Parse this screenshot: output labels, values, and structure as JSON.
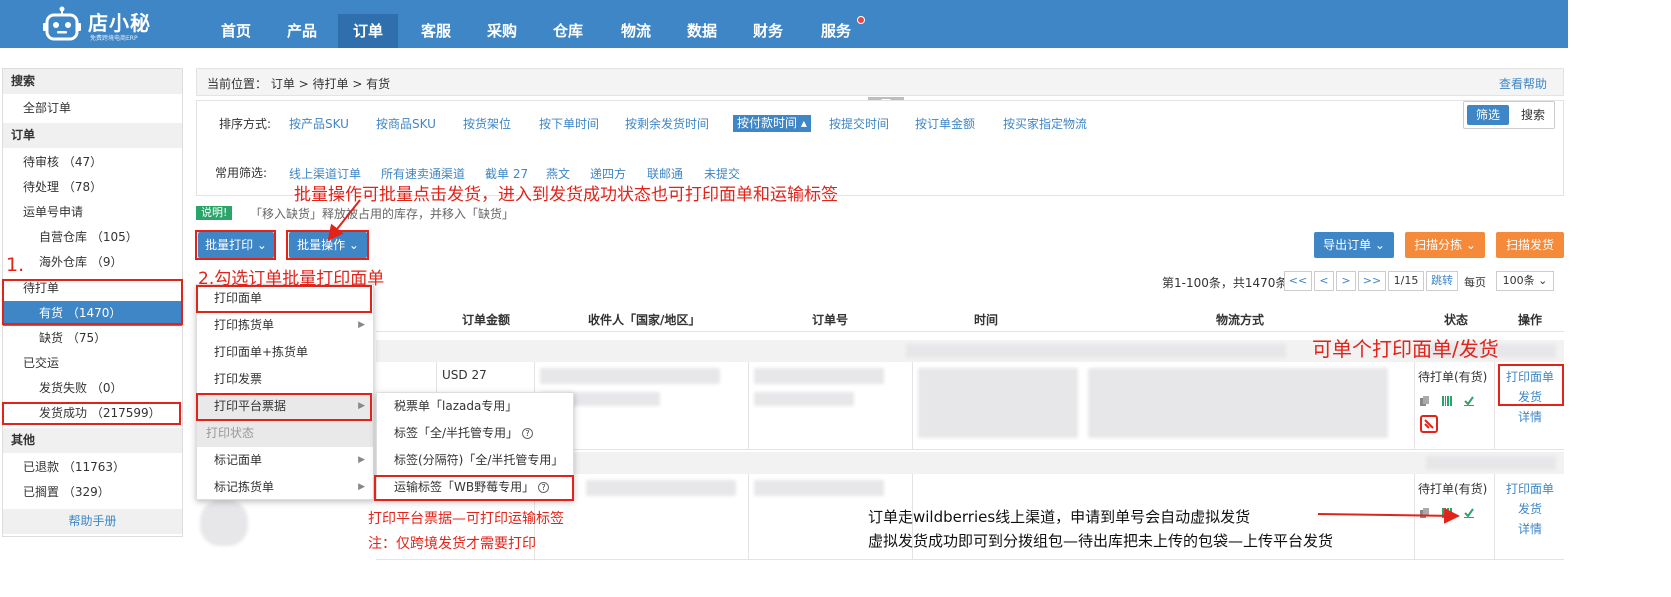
{
  "brand": {
    "name": "店小秘",
    "slogan": "免费跨境电商ERP"
  },
  "nav": [
    {
      "label": "首页"
    },
    {
      "label": "产品"
    },
    {
      "label": "订单"
    },
    {
      "label": "客服"
    },
    {
      "label": "采购"
    },
    {
      "label": "仓库"
    },
    {
      "label": "物流"
    },
    {
      "label": "数据"
    },
    {
      "label": "财务"
    },
    {
      "label": "服务"
    }
  ],
  "nav_active": "订单",
  "sidebar": {
    "search_head": "搜索",
    "all_orders": "全部订单",
    "orders_head": "订单",
    "pending_review": "待审核 （47）",
    "pending_process": "待处理 （78）",
    "waybill_apply": "运单号申请",
    "self_warehouse": "自营仓库 （105）",
    "overseas_warehouse": "海外仓库 （9）",
    "to_print": "待打单",
    "in_stock": "有货 （1470）",
    "out_of_stock": "缺货 （75）",
    "shipped": "已交运",
    "ship_failed": "发货失败 （0）",
    "ship_success": "发货成功 （217599）",
    "other_head": "其他",
    "refunded": "已退款 （11763）",
    "on_hold": "已搁置 （329）",
    "help": "帮助手册"
  },
  "breadcrumb": "当前位置： 订单 > 待打单 > 有货",
  "help_link": "查看帮助",
  "sort": {
    "label": "排序方式:",
    "options": [
      "按产品SKU",
      "按商品SKU",
      "按货架位",
      "按下单时间",
      "按剩余发货时间",
      "按付款时间 ▴",
      "按提交时间",
      "按订单金额",
      "按买家指定物流"
    ]
  },
  "filter_toggle": {
    "filter": "筛选",
    "search": "搜索"
  },
  "common_filter": {
    "label": "常用筛选:",
    "options": [
      "线上渠道订单",
      "所有速卖通渠道",
      "截单 27",
      "燕文",
      "递四方",
      "联邮通",
      "未提交"
    ]
  },
  "notice": {
    "badge": "说明!",
    "text": "「移入缺货」释放被占用的库存，并移入「缺货」"
  },
  "toolbar": {
    "batch_print": "批量打印 ⌄",
    "batch_ops": "批量操作 ⌄",
    "export": "导出订单 ⌄",
    "scan_sort": "扫描分拣 ⌄",
    "scan_ship": "扫描发货"
  },
  "pager": {
    "summary": "第1-100条，共1470条",
    "first": "<<",
    "prev": "<",
    "next": ">",
    "last": ">>",
    "page": "1/15",
    "jump": "跳转",
    "per_page_label": "每页",
    "per_page": "100条 ⌄"
  },
  "table": {
    "headers": [
      "订单金额",
      "收件人「国家/地区」",
      "订单号",
      "时间",
      "物流方式",
      "状态",
      "操作"
    ],
    "rows": [
      {
        "amount": "USD 27",
        "status": "待打单(有货)",
        "ops": [
          "打印面单",
          "发货",
          "详情"
        ]
      },
      {
        "amount": "",
        "status": "待打单(有货)",
        "ops": [
          "打印面单",
          "发货",
          "详情"
        ]
      }
    ]
  },
  "print_menu": {
    "items": [
      "打印面单",
      "打印拣货单",
      "打印面单+拣货单",
      "打印发票",
      "打印平台票据"
    ],
    "group": "打印状态",
    "status_items": [
      "标记面单",
      "标记拣货单"
    ]
  },
  "platform_submenu": [
    "税票单「lazada专用」",
    "标签「全/半托管专用」",
    "标签(分隔符)「全/半托管专用」",
    "运输标签「WB野莓专用」"
  ],
  "annotations": {
    "batch_ops_note": "批量操作可批量点击发货，进入到发货成功状态也可打印面单和运输标签",
    "step1": "1.",
    "step2": "2.勾选订单批量打印面单",
    "single_print": "可单个打印面单/发货",
    "platform_note": "打印平台票据—可打印运输标签",
    "cross_border_note": "注：仅跨境发货才需要打印",
    "wb_note_1": "订单走wildberries线上渠道，申请到单号会自动虚拟发货",
    "wb_note_2": "虚拟发货成功即可到分拨组包—待出库把未上传的包袋—上传平台发货"
  },
  "colors": {
    "primary": "#3f86c6",
    "orange": "#f58a3b",
    "annotation_red": "#e2231a",
    "green": "#2aa56a"
  }
}
